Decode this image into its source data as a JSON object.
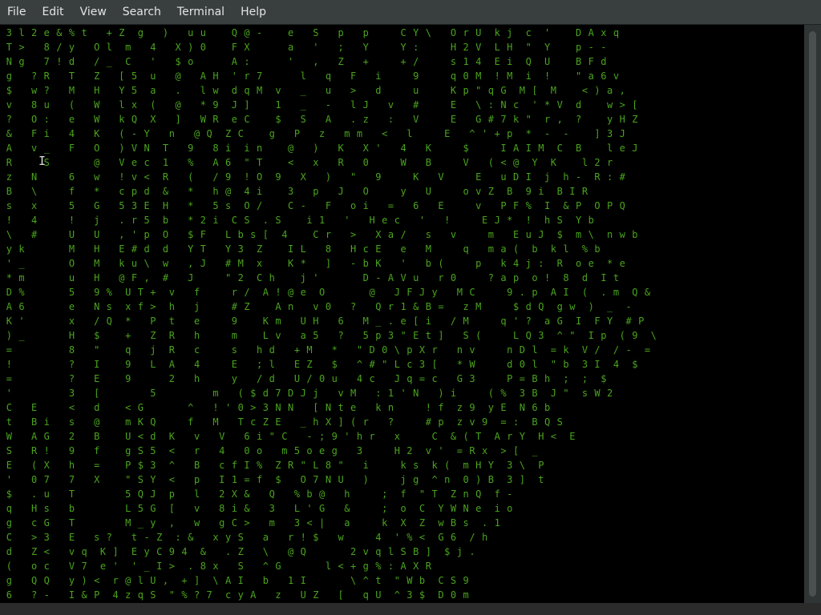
{
  "menubar": {
    "items": [
      "File",
      "Edit",
      "View",
      "Search",
      "Terminal",
      "Help"
    ]
  },
  "terminal": {
    "text_color": "#4aa31c",
    "background": "#000000",
    "lines": [
      " 3 l 2 e & % t   + Z  g   )   u u    Q @ -    e   S   p   p     C Y \\   O r U  k j  c  '    D A x q",
      " T >   8 / y   O l  m   4   X ) 0    F X      a   '   ;   Y     Y :     H 2 V  L H  \"  Y    p - -",
      " N g   7 ! d   / _  C   '   $ o      A :      '   ,   Z   +     + /     s 1 4  E i  Q  U    B F d",
      " g   ? R   T   Z   [ 5  u   @   A H  ' r 7      l   q   F   i     9     q 0 M  ! M  i  !    \" a 6 v",
      " $   w ?   M   H   Y 5  a   .   l w  d q M  v   _   u   >   d     u     K p \" q G  M [  M    < ) a ,",
      " v   8 u   (   W   l x  (   @   * 9  J ]    1   _   -   l J   v   #     E   \\ : N c  ' * V  d    w > [",
      " ?   O :   e   W   k Q  X   ]   W R  e C    $   S   A   . z   :   V     E   G # 7 k \"  r ,  ?    y H Z",
      " &   F i   4   K   ( - Y   n   @ Q  Z C    g   P   z   m m   <   l     E   ^ ' + p  *  -  -    ] 3 J",
      " A   v _   F   O   ) V N  T   9   8 i  i n    @   )   K   X '   4   K     $     I A I M  C  B    l e J",
      " R     S       @   V e c  1   %   A 6  \" T    <   x   R   0     W   B     V   ( < @  Y  K    l 2 r",
      " z   N     6   w   ! v <  R   (   / 9  ! O  9   X   )   \"   9     K   V     E   u D I  j  h -  R : #",
      " B   \\     f   *   c p d  &   *   h @  4 i    3   p   J   O     y   U     o v Z  B  9 i  B I R",
      " s   x     5   G   5 3 E  H   *   5 s  O /    C -   F   o i   =   6   E     v   P F %  I  & P  O P Q",
      " !   4     !   j   . r 5  b   * 2 i  C S  . S    i 1   '   H e c   '   !     E J *  !  h S  Y b",
      " \\   #     U   U   , ' p  O   $ F   L b s [  4    C r   >   X a /   s   v     m   E u J  $  m \\  n w b",
      " y k       M   H   E # d  d   Y T   Y 3  Z    I L   8   H c E   e   M     q   m a (  b  k l  % b",
      " ' _       O   M   k u \\  w   , J   # M  x    K *   ]   - b K   '   b (     p   k 4 j :  R  o e  * e",
      " * m       u   H   @ F ,  #   J     \" 2  C h    j '       D - A V u   r 0     ? a p  o !  8  d  I t",
      " D %       5   9 %  U T +  v   f     r /  A ! @ e  O       @   J F J y   M C     9 . p  A I  (  . m  Q &",
      " A 6       e   N s  x f >  h   j     # Z    A n   v 0   ?   Q r 1 & B =   z M     $ d Q  g w  )  _  -",
      " K '       x   / Q  *   P  t   e     9    K m   U H   6   M _ . e [ i   / M     q ' ?  a G  I  F Y  # P",
      " ) _       H   $    +   Z  R   h     m    L v   a 5   ?   5 p 3 \" E t ]   S (     L Q 3  ^ \"  I p  ( 9  \\",
      " =         8   \"    q   j  R   c     s   h d   + M   *   \" D 0 \\ p X r   n v     n D l  = k  V /  / -  =",
      " !         ?   I    9   L  A   4     E   ; l   E Z   $   ^ # \" L c 3 [   * W     d 0 l  \" b  3 I  4  $",
      " =         ?   E    9      2   h     y   / d   U / 0 u   4 c   J q = c   G 3     P = B h  ;  ;  $",
      " '         3   [        5         m   ( $ d 7 D J j   v M   : 1 ' N   ) i     ( %  3 B  J \"  s W 2",
      " C   E     <   d    < G       ^   ! ' 0 > 3 N N   [ N t e   k n     ! f  z 9  y E  N 6 b",
      " t   B i   s   @    m K Q     f   M   T c Z E   _ h X ] ( r   ?     # p  z v 9  = :  B Q S",
      " W   A G   2   B    U < d  K   v   V   6 i \" C   - ; 9 ' h r   x     C  & ( T  A r Y  H <  E",
      " S   R !   9   f    g S 5  <   r   4   0 o   m 5 o e g   3     H 2  v '  = R x  > [  _",
      " E   ( X   h   =    P $ 3  ^   B   c f I %  Z R \" L 8 \"   i     k s  k (  m H Y  3 \\  P",
      " '   0 7   7   X    \" S Y  <   p   I 1 = f  $   O 7 N U   )     j g  ^ n  0 ) B  3 ]  t",
      " $   . u   T        5 Q J  p   l   2 X &   Q   % b @   h     ;  f  \" T  Z n Q  f -",
      " q   H s   b        L 5 G  [   v   8 i &   3   L ' G   &     ;  o  C  Y W N e  i o",
      " g   c G   T        M _ y  ,   w   g C >   m   3 < |   a     k  X  Z  w B s  . 1",
      " C   > 3   E   s ?   t - Z  : &   x y S   a   r ! $   w     4  ' % <  G 6  / h",
      " d   Z <   v q  K ]  E y C 9 4  &   . Z   \\   @ Q       2 v q l S B ]  $ j .",
      " (   o c   V 7  e '  ' _ I >  . 8 x   S   ^ G       l < + g % : A X R",
      " g   Q Q   y ) <  r @ l U ,  + ]  \\ A I   b   1 I       \\ ^ t  \" W b  C S 9",
      " 6   ? -   I & P  4 z q S  \" % ? 7  c y A   z   U Z   [   q U  ^ 3 $  D 0 m"
    ]
  }
}
